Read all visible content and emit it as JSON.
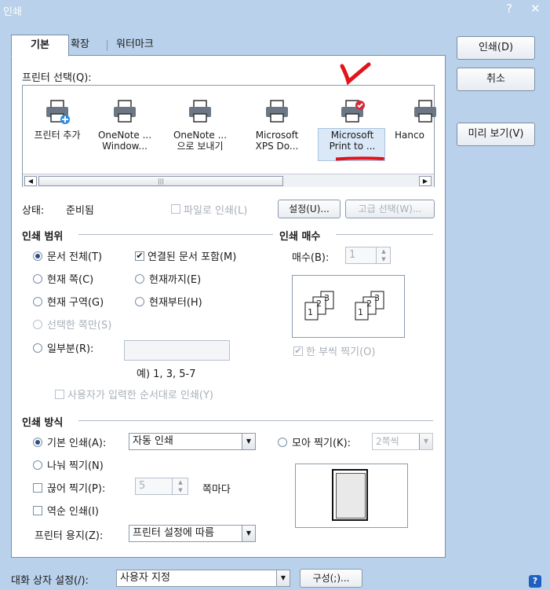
{
  "window": {
    "title": "인쇄",
    "help_icon": "?",
    "close_icon": "✕"
  },
  "tabs": [
    {
      "label": "기본"
    },
    {
      "label": "확장"
    },
    {
      "label": "워터마크"
    }
  ],
  "buttons": {
    "print": "인쇄(D)",
    "cancel": "취소",
    "preview": "미리 보기(V)"
  },
  "printer_select": {
    "label": "프린터 선택(Q):",
    "items": [
      {
        "line1": "프린터 추가",
        "line2": ""
      },
      {
        "line1": "OneNote ...",
        "line2": "Window..."
      },
      {
        "line1": "OneNote ...",
        "line2": "으로 보내기"
      },
      {
        "line1": "Microsoft",
        "line2": "XPS Do..."
      },
      {
        "line1": "Microsoft",
        "line2": "Print to ..."
      },
      {
        "line1": "Hanco",
        "line2": ""
      }
    ]
  },
  "status": {
    "label": "상태:",
    "value": "준비됨",
    "print_to_file": "파일로 인쇄(L)",
    "settings": "설정(U)...",
    "advanced": "고급 선택(W)..."
  },
  "print_range": {
    "title": "인쇄 범위",
    "all": "문서 전체(T)",
    "include_linked": "연결된 문서 포함(M)",
    "current_page": "현재 쪽(C)",
    "up_to_current": "현재까지(E)",
    "current_section": "현재 구역(G)",
    "from_current": "현재부터(H)",
    "selected_pages": "선택한 쪽만(S)",
    "partial": "일부분(R):",
    "example": "예) 1, 3, 5-7",
    "user_order": "사용자가 입력한 순서대로 인쇄(Y)"
  },
  "copies": {
    "title": "인쇄 매수",
    "label": "매수(B):",
    "value": "1",
    "collate": "한 부씩 찍기(O)",
    "collate_pages": [
      "1",
      "2",
      "3"
    ]
  },
  "print_method": {
    "title": "인쇄 방식",
    "basic": "기본 인쇄(A):",
    "basic_value": "자동 인쇄",
    "split": "나눠 찍기(N)",
    "cut": "끊어 찍기(P):",
    "cut_value": "5",
    "per_page": "쪽마다",
    "reverse": "역순 인쇄(I)",
    "combine": "모아 찍기(K):",
    "combine_value": "2쪽씩",
    "paper_label": "프린터 용지(Z):",
    "paper_value": "프린터 설정에 따름"
  },
  "footer": {
    "dialog_setting_label": "대화 상자 설정(/):",
    "dialog_setting_value": "사용자 지정",
    "config": "구성(;)..."
  },
  "colors": {
    "background": "#b9d1ea",
    "annotation_red": "#e0141a",
    "selected_highlight": "#dbe8f7",
    "help_blue": "#1f5fbf"
  }
}
